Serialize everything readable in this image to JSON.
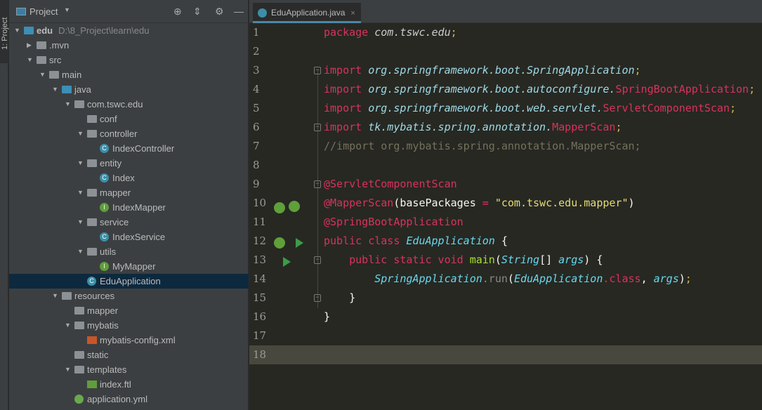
{
  "side_strip": {
    "label": "1: Project"
  },
  "project_panel": {
    "title": "Project",
    "tree": [
      {
        "label": "edu",
        "path": "D:\\8_Project\\learn\\edu",
        "level": 0,
        "arrow": "down",
        "icon": "module-folder"
      },
      {
        "label": ".mvn",
        "level": 1,
        "arrow": "right",
        "icon": "folder"
      },
      {
        "label": "src",
        "level": 1,
        "arrow": "down",
        "icon": "folder"
      },
      {
        "label": "main",
        "level": 2,
        "arrow": "down",
        "icon": "folder"
      },
      {
        "label": "java",
        "level": 3,
        "arrow": "down",
        "icon": "source-folder"
      },
      {
        "label": "com.tswc.edu",
        "level": 4,
        "arrow": "down",
        "icon": "package"
      },
      {
        "label": "conf",
        "level": 5,
        "arrow": "none",
        "icon": "package"
      },
      {
        "label": "controller",
        "level": 5,
        "arrow": "down",
        "icon": "package"
      },
      {
        "label": "IndexController",
        "level": 6,
        "arrow": "none",
        "icon": "class"
      },
      {
        "label": "entity",
        "level": 5,
        "arrow": "down",
        "icon": "package"
      },
      {
        "label": "Index",
        "level": 6,
        "arrow": "none",
        "icon": "class"
      },
      {
        "label": "mapper",
        "level": 5,
        "arrow": "down",
        "icon": "package"
      },
      {
        "label": "IndexMapper",
        "level": 6,
        "arrow": "none",
        "icon": "interface"
      },
      {
        "label": "service",
        "level": 5,
        "arrow": "down",
        "icon": "package"
      },
      {
        "label": "IndexService",
        "level": 6,
        "arrow": "none",
        "icon": "class"
      },
      {
        "label": "utils",
        "level": 5,
        "arrow": "down",
        "icon": "package"
      },
      {
        "label": "MyMapper",
        "level": 6,
        "arrow": "none",
        "icon": "interface"
      },
      {
        "label": "EduApplication",
        "level": 5,
        "arrow": "none",
        "icon": "spring-class",
        "selected": true
      },
      {
        "label": "resources",
        "level": 3,
        "arrow": "down",
        "icon": "resources-folder"
      },
      {
        "label": "mapper",
        "level": 4,
        "arrow": "none",
        "icon": "folder"
      },
      {
        "label": "mybatis",
        "level": 4,
        "arrow": "down",
        "icon": "folder"
      },
      {
        "label": "mybatis-config.xml",
        "level": 5,
        "arrow": "none",
        "icon": "xml"
      },
      {
        "label": "static",
        "level": 4,
        "arrow": "none",
        "icon": "folder"
      },
      {
        "label": "templates",
        "level": 4,
        "arrow": "down",
        "icon": "folder"
      },
      {
        "label": "index.ftl",
        "level": 5,
        "arrow": "none",
        "icon": "ftl"
      },
      {
        "label": "application.yml",
        "level": 4,
        "arrow": "none",
        "icon": "yml"
      }
    ]
  },
  "editor_tab": {
    "label": "EduApplication.java",
    "close": "×"
  },
  "code": {
    "current_line": 18,
    "lines": [
      [
        [
          "kw",
          "package "
        ],
        [
          "pkgw",
          "com.tswc.edu"
        ],
        [
          "semi",
          ";"
        ]
      ],
      [],
      [
        [
          "kw",
          "import "
        ],
        [
          "pkg",
          "org.springframework.boot.SpringApplication"
        ],
        [
          "semi",
          ";"
        ]
      ],
      [
        [
          "kw",
          "import "
        ],
        [
          "pkg",
          "org.springframework.boot.autoconfigure."
        ],
        [
          "cls2",
          "SpringBootApplication"
        ],
        [
          "semi",
          ";"
        ]
      ],
      [
        [
          "kw",
          "import "
        ],
        [
          "pkg",
          "org.springframework.boot.web.servlet."
        ],
        [
          "cls2",
          "ServletComponentScan"
        ],
        [
          "semi",
          ";"
        ]
      ],
      [
        [
          "kw",
          "import "
        ],
        [
          "pkg",
          "tk.mybatis.spring.annotation."
        ],
        [
          "cls2",
          "MapperScan"
        ],
        [
          "semi",
          ";"
        ]
      ],
      [
        [
          "cmt",
          "//import org.mybatis.spring.annotation.MapperScan;"
        ]
      ],
      [],
      [
        [
          "ann",
          "@ServletComponentScan"
        ]
      ],
      [
        [
          "ann",
          "@MapperScan"
        ],
        [
          "txt2",
          "(basePackages "
        ],
        [
          "op",
          "="
        ],
        [
          "str",
          " \"com.tswc.edu.mapper\""
        ],
        [
          "txt2",
          ")"
        ]
      ],
      [
        [
          "ann",
          "@SpringBootApplication"
        ]
      ],
      [
        [
          "kw",
          "public class "
        ],
        [
          "ity",
          "EduApplication"
        ],
        [
          "txt2",
          " {"
        ]
      ],
      [
        [
          "txt2",
          "    "
        ],
        [
          "kw",
          "public static void "
        ],
        [
          "fn",
          "main"
        ],
        [
          "txt2",
          "("
        ],
        [
          "ity",
          "String"
        ],
        [
          "txt2",
          "[] "
        ],
        [
          "ity",
          "args"
        ],
        [
          "txt2",
          ") {"
        ]
      ],
      [
        [
          "txt2",
          "        "
        ],
        [
          "ity",
          "SpringApplication"
        ],
        [
          "mth",
          ".run"
        ],
        [
          "txt2",
          "("
        ],
        [
          "ity",
          "EduApplication"
        ],
        [
          "kw",
          ".class"
        ],
        [
          "txt2",
          ", "
        ],
        [
          "ity",
          "args"
        ],
        [
          "txt2",
          ")"
        ],
        [
          "semi",
          ";"
        ]
      ],
      [
        [
          "txt2",
          "    }"
        ]
      ],
      [
        [
          "txt2",
          "}"
        ]
      ],
      [],
      []
    ]
  }
}
